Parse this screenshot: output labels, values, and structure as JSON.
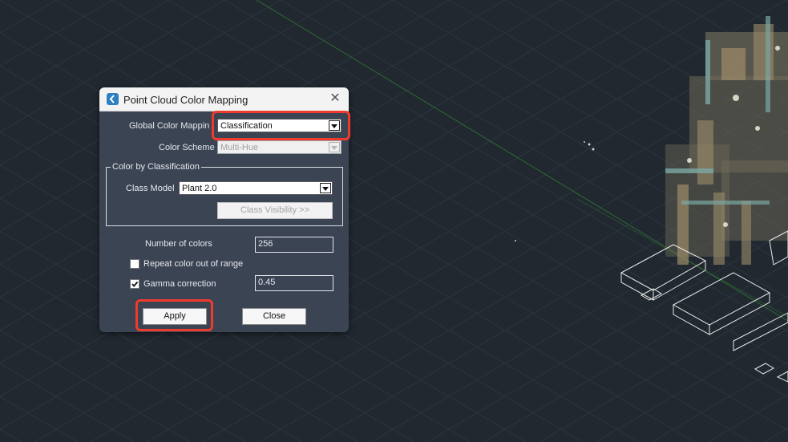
{
  "dialog": {
    "title": "Point Cloud Color Mapping",
    "global_color_mapping": {
      "label": "Global Color Mappin",
      "value": "Classification"
    },
    "color_scheme": {
      "label": "Color Scheme",
      "value": "Multi-Hue",
      "disabled": true
    },
    "classification_group": {
      "title": "Color by Classification",
      "class_model": {
        "label": "Class Model",
        "value": "Plant 2.0"
      },
      "class_visibility_button": "Class Visibility >>"
    },
    "number_of_colors": {
      "label": "Number of colors",
      "value": "256"
    },
    "repeat_color": {
      "label": "Repeat color out of range",
      "checked": false
    },
    "gamma_correction": {
      "label": "Gamma correction",
      "checked": true,
      "value": "0.45"
    },
    "apply_button": "Apply",
    "close_button": "Close"
  },
  "colors": {
    "background": "#212830",
    "dialog_bg": "#3b4453",
    "highlight": "#ef3b2d",
    "grid": "#2f3843"
  }
}
